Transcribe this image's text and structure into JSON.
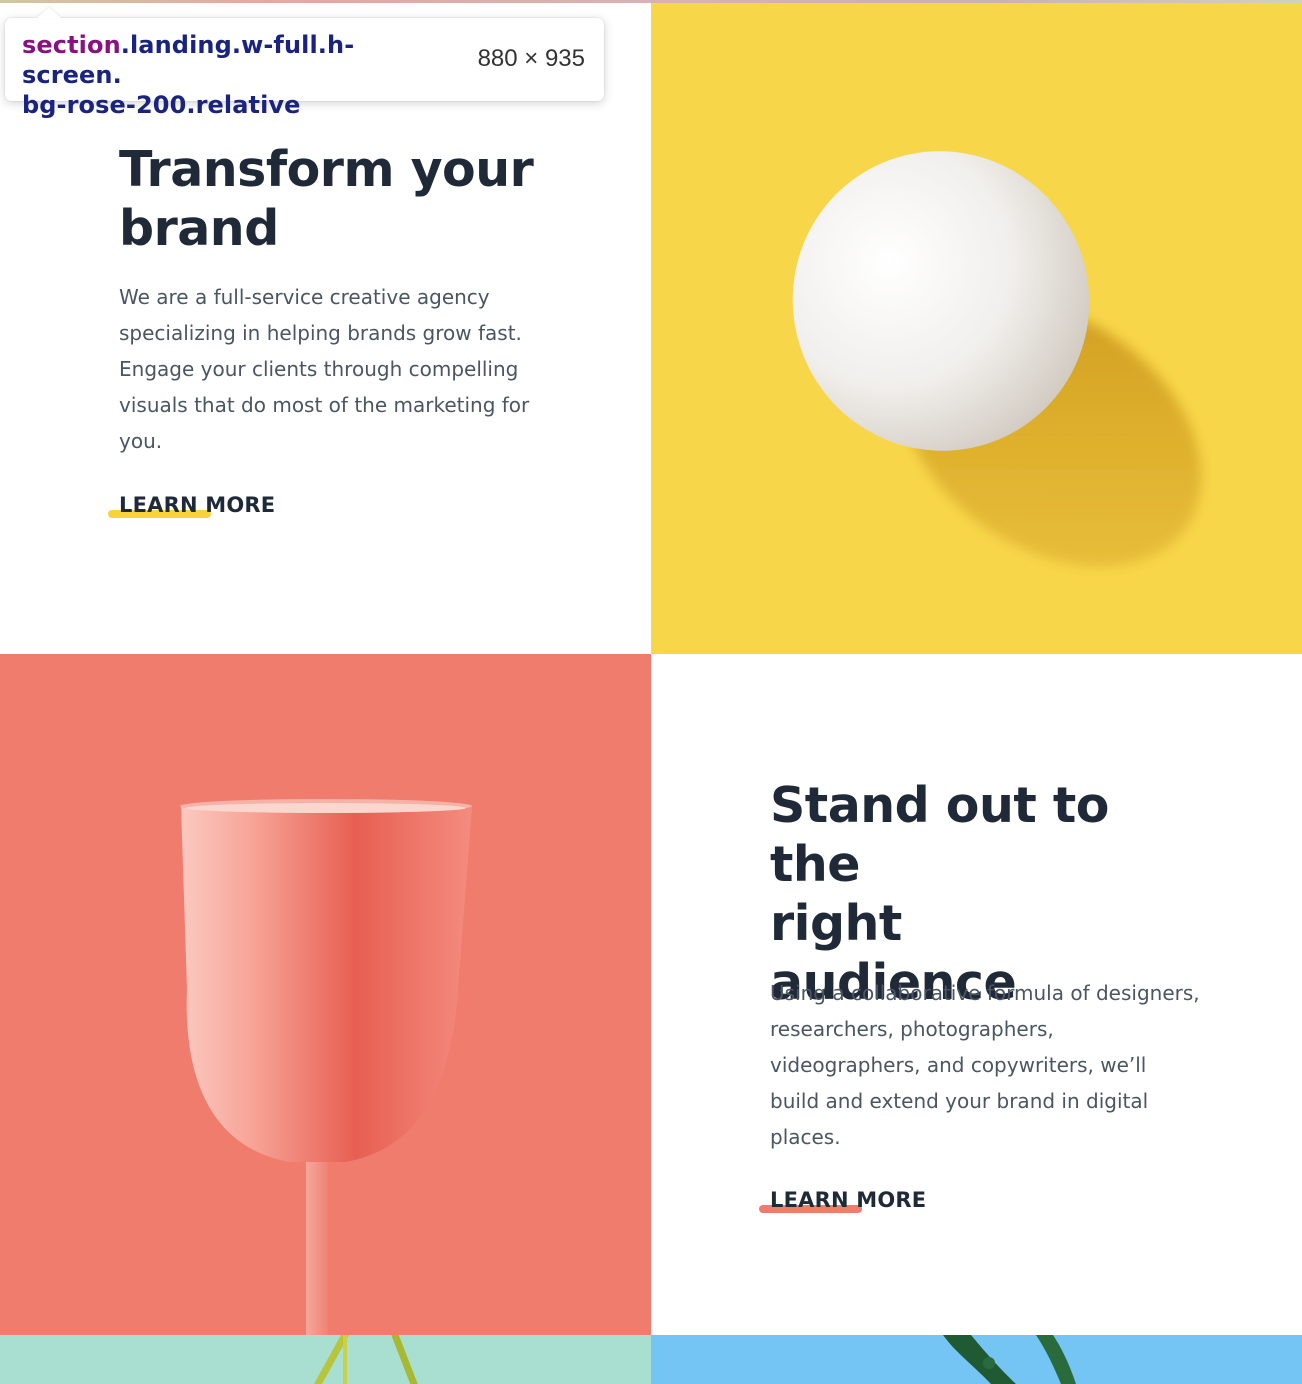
{
  "devtools_tooltip": {
    "selector_tag": "section",
    "selector_line1": ".landing.w-full.h-screen.",
    "selector_line2": "bg-rose-200.relative",
    "dimensions": "880 × 935"
  },
  "sections": [
    {
      "title_line1": "Transform your",
      "title_line2": "brand",
      "body": "We are a full-service creative agency specializing in helping brands grow fast. Engage your clients through compelling visuals that do most of the marketing for you.",
      "cta": "LEARN MORE",
      "underline_color": "#f7d33d",
      "image": "egg-on-yellow"
    },
    {
      "title_line1": "Stand out to the",
      "title_line2": "right",
      "title_line3": "audience",
      "body": "Using a collaborative formula of designers, researchers, photographers, videographers, and copywriters, we’ll build and extend your brand in digital places.",
      "cta": "LEARN MORE",
      "underline_color": "#ef7c6d",
      "image": "pink-glass-on-coral"
    }
  ],
  "colors": {
    "heading": "#1f2937",
    "body": "#4b5563",
    "yellow": "#f8d64a",
    "coral": "#ef7c6d",
    "mint": "#a9dfd0",
    "sky": "#74c4f4"
  }
}
